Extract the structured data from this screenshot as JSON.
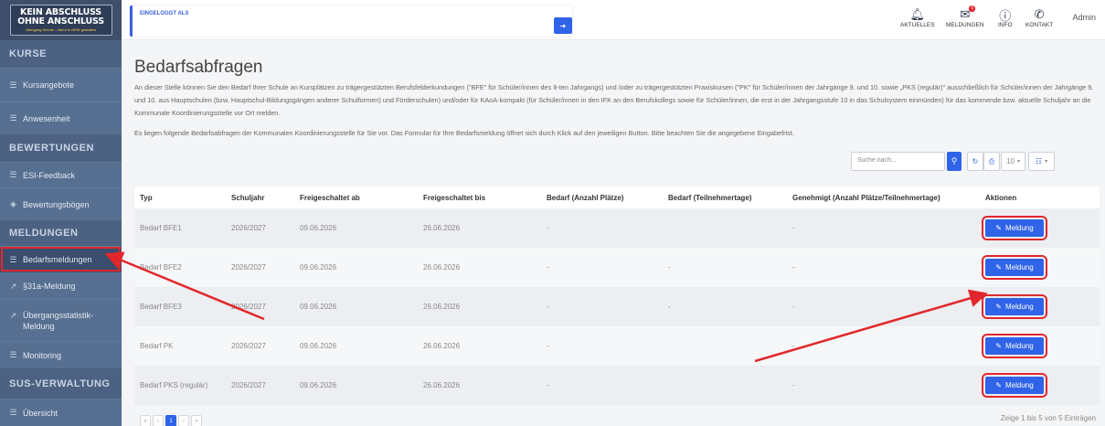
{
  "logo": {
    "line1": "KEIN ABSCHLUSS",
    "line2": "OHNE ANSCHLUSS",
    "sub": "Übergang Schule – Beruf in NRW gestalten"
  },
  "sidebar": {
    "sections": [
      {
        "title": "KURSE",
        "items": [
          {
            "label": "Kursangebote",
            "icon": "list-icon"
          },
          {
            "label": "Anwesenheit",
            "icon": "list-icon"
          }
        ]
      },
      {
        "title": "BEWERTUNGEN",
        "items": [
          {
            "label": "ESI-Feedback",
            "icon": "list-icon"
          },
          {
            "label": "Bewertungsbögen",
            "icon": "tags-icon"
          }
        ]
      },
      {
        "title": "MELDUNGEN",
        "items": [
          {
            "label": "Bedarfsmeldungen",
            "icon": "list-icon"
          },
          {
            "label": "§31a-Meldung",
            "icon": "chart-icon"
          },
          {
            "label": "Übergangsstatistik-Meldung",
            "icon": "chart-icon"
          },
          {
            "label": "Monitoring",
            "icon": "list-icon"
          }
        ]
      },
      {
        "title": "SUS-VERWALTUNG",
        "items": [
          {
            "label": "Übersicht",
            "icon": "list-icon"
          }
        ]
      }
    ]
  },
  "topbar": {
    "login_label": "EINGELOGGT ALS",
    "nav": [
      {
        "label": "AKTUELLES",
        "icon": "bell-icon"
      },
      {
        "label": "MELDUNGEN",
        "icon": "envelope-icon",
        "badge": "0"
      },
      {
        "label": "INFO",
        "icon": "info-icon"
      },
      {
        "label": "KONTAKT",
        "icon": "phone-icon"
      }
    ],
    "user": "Admin"
  },
  "main": {
    "title": "Bedarfsabfragen",
    "description": "An dieser Stelle können Sie den Bedarf Ihrer Schule an Kursplätzen zu trägergestützten Berufsfelderkundungen (\"BFE\" für Schüler/innen des 8-ten Jahrgangs) und /oder zu trägergestützten Praxiskursen (\"PK\" für Schüler/innen der Jahrgänge 9. und 10. sowie „PKS (regulär)\" ausschließlich für Schüler/innen der Jahrgänge 9. und 10. aus Hauptschulen (bzw. Hauptschul-Bildungsgängen anderer Schulformen) und Förderschulen) und/oder für KAoA-kompakt (für Schüler/innen in den IFK an den Berufskollegs sowie für Schüler/innen, die erst in der Jahrgangsstufe 10 in das Schulsystem einmünden) für das kommende bzw. aktuelle Schuljahr an die Kommunale Koordinierungsstelle vor Ort melden.",
    "note": "Es liegen folgende Bedarfsabfragen der Kommunalen Koordinierungsstelle für Sie vor. Das Formular für Ihre Bedarfsmeldung öffnet sich durch Klick auf den jeweiligen Button. Bitte beachten Sie die angegebene Eingabefrist.",
    "search_placeholder": "Suche nach...",
    "page_size": "10",
    "columns": [
      "Typ",
      "Schuljahr",
      "Freigeschaltet ab",
      "Freigeschaltet bis",
      "Bedarf (Anzahl Plätze)",
      "Bedarf (Teilnehmertage)",
      "Genehmigt (Anzahl Plätze/Teilnehmertage)",
      "Aktionen"
    ],
    "rows": [
      {
        "typ": "Bedarf BFE1",
        "jahr": "2026/2027",
        "ab": "09.06.2026",
        "bis": "26.06.2026",
        "plaetze": "-",
        "tage": "",
        "genehmigt": "-",
        "action": "Meldung"
      },
      {
        "typ": "Bedarf BFE2",
        "jahr": "2026/2027",
        "ab": "09.06.2026",
        "bis": "26.06.2026",
        "plaetze": "-",
        "tage": "-",
        "genehmigt": "-",
        "action": "Meldung"
      },
      {
        "typ": "Bedarf BFE3",
        "jahr": "2026/2027",
        "ab": "09.06.2026",
        "bis": "26.06.2026",
        "plaetze": "-",
        "tage": "-",
        "genehmigt": "-",
        "action": "Meldung"
      },
      {
        "typ": "Bedarf PK",
        "jahr": "2026/2027",
        "ab": "09.06.2026",
        "bis": "26.06.2026",
        "plaetze": "-",
        "tage": "",
        "genehmigt": "-",
        "action": "Meldung"
      },
      {
        "typ": "Bedarf PKS (regulär)",
        "jahr": "2026/2027",
        "ab": "09.06.2026",
        "bis": "26.06.2026",
        "plaetze": "-",
        "tage": "",
        "genehmigt": "-",
        "action": "Meldung"
      }
    ],
    "pager": {
      "first": "«",
      "prev": "‹",
      "current": "1",
      "next": "›",
      "last": "»"
    },
    "summary": "Zeige 1 bis 5 von 5 Einträgen"
  },
  "colors": {
    "sidebar": "#4d6283",
    "accent": "#2f63e8",
    "highlight": "#e1272c"
  }
}
